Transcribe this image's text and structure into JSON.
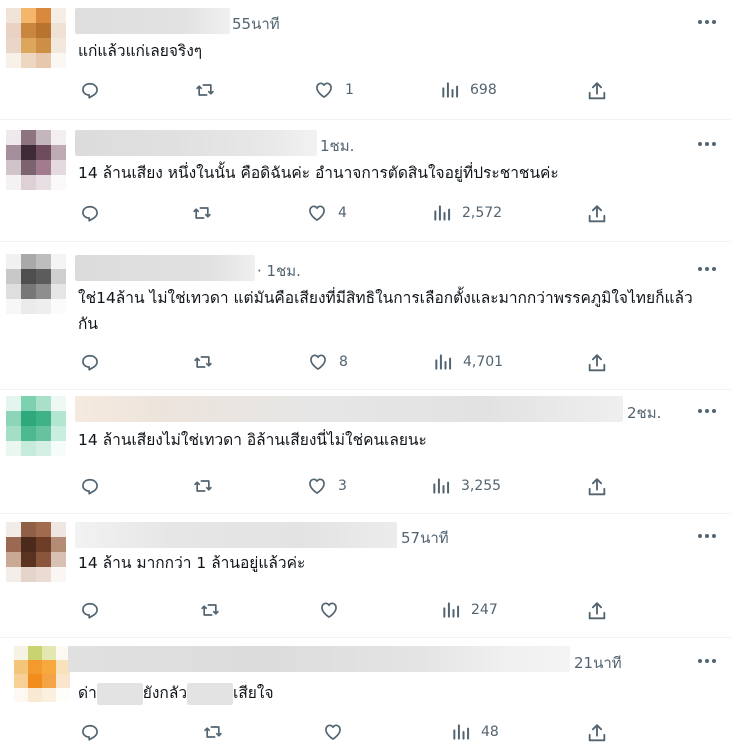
{
  "posts": [
    {
      "time": "55นาที",
      "text": "แก่แล้วแก่เลยจริงๆ",
      "likes": "1",
      "views": "698"
    },
    {
      "time": "1ชม.",
      "text": "14 ล้านเสียง หนึ่งในนั้น คือดิฉันค่ะ อำนาจการตัดสินใจอยู่ที่ประชาชนค่ะ",
      "likes": "4",
      "retweets": "",
      "views": "2,572"
    },
    {
      "time": "· 1ชม.",
      "text": "ใช่14ล้าน ไม่ใช่เทวดา แต่มันคือเสียงที่มีสิทธิในการเลือกตั้งและมากกว่าพรรคภูมิใจไทยก็แล้วกัน",
      "likes": "8",
      "views": "4,701"
    },
    {
      "time": "2ชม.",
      "text": "14 ล้านเสียงไม่ใช่เทวดา อิล้านเสียงนี่ไม่ใช่คนเลยนะ",
      "likes": "3",
      "views": "3,255"
    },
    {
      "time": "57นาที",
      "text": "14 ล้าน มากกว่า 1 ล้านอยู่แล้วค่ะ",
      "likes": "",
      "views": "247"
    },
    {
      "time": "21นาที",
      "text_a": "ด่า",
      "text_b": "ยังกลัว",
      "text_c": "เสียใจ",
      "likes": "",
      "views": "48"
    }
  ],
  "icons": {
    "reply": "reply-icon",
    "retweet": "retweet-icon",
    "like": "heart-icon",
    "views": "views-icon",
    "share": "share-icon",
    "more": "more-icon"
  }
}
